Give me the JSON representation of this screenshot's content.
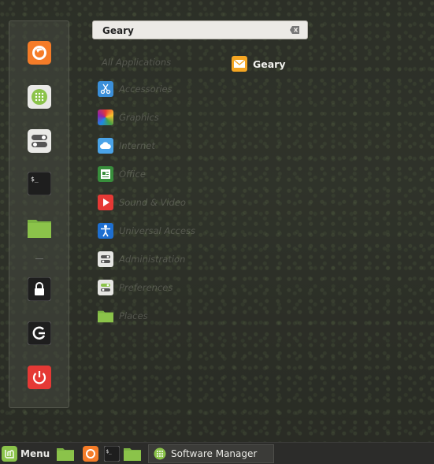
{
  "search": {
    "value": "Geary",
    "placeholder": ""
  },
  "categories": {
    "all": "All Applications",
    "items": [
      {
        "label": "Accessories",
        "icon": "scissors-icon"
      },
      {
        "label": "Graphics",
        "icon": "graphics-icon"
      },
      {
        "label": "Internet",
        "icon": "cloud-icon"
      },
      {
        "label": "Office",
        "icon": "office-icon"
      },
      {
        "label": "Sound & Video",
        "icon": "play-icon"
      },
      {
        "label": "Universal Access",
        "icon": "accessibility-icon"
      },
      {
        "label": "Administration",
        "icon": "toggle-icon"
      },
      {
        "label": "Preferences",
        "icon": "toggle-icon"
      },
      {
        "label": "Places",
        "icon": "folder-icon"
      }
    ]
  },
  "results": [
    {
      "label": "Geary",
      "icon": "mail-icon"
    }
  ],
  "favorites": [
    {
      "name": "firefox",
      "icon": "firefox-icon"
    },
    {
      "name": "software-manager",
      "icon": "grid-icon"
    },
    {
      "name": "system-settings",
      "icon": "toggle-icon"
    },
    {
      "name": "terminal",
      "icon": "terminal-icon"
    },
    {
      "name": "files",
      "icon": "folder-icon"
    },
    {
      "name": "lock-screen",
      "icon": "lock-icon"
    },
    {
      "name": "logout",
      "icon": "logout-icon"
    },
    {
      "name": "quit",
      "icon": "power-icon"
    }
  ],
  "taskbar": {
    "menu_label": "Menu",
    "window_label": "Software Manager"
  },
  "colors": {
    "accent_green": "#8bc34a",
    "firefox_orange": "#f57c28",
    "power_red": "#e53935"
  }
}
